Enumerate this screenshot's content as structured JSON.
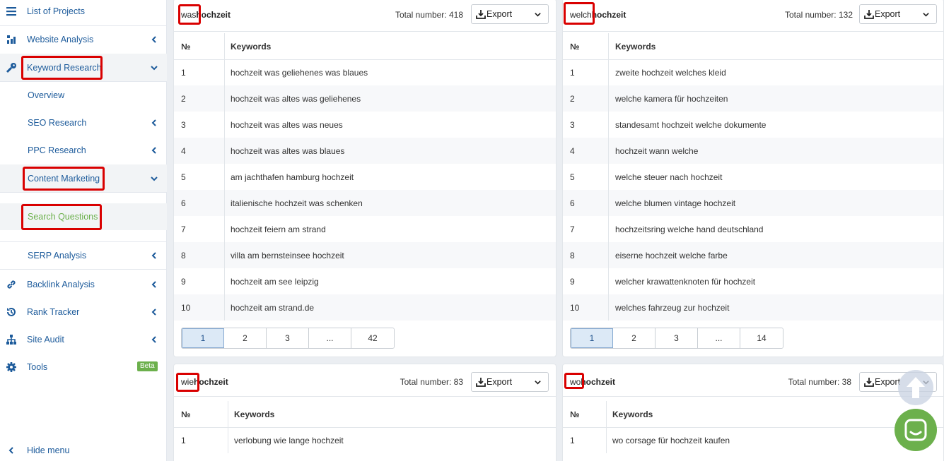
{
  "sidebar": {
    "list_projects": "List of Projects",
    "website_analysis": "Website Analysis",
    "keyword_research": "Keyword Research",
    "overview": "Overview",
    "seo_research": "SEO Research",
    "ppc_research": "PPC Research",
    "content_marketing": "Content Marketing",
    "search_questions": "Search Questions",
    "serp_analysis": "SERP Analysis",
    "backlink_analysis": "Backlink Analysis",
    "rank_tracker": "Rank Tracker",
    "site_audit": "Site Audit",
    "tools": "Tools",
    "beta": "Beta",
    "hide_menu": "Hide menu"
  },
  "colors": {
    "accent": "#1d5b9b",
    "highlight": "#d90000",
    "green": "#6cb04c"
  },
  "panels": [
    {
      "qword": "was",
      "rest": "hochzeit",
      "total": "Total number: 418",
      "export": "Export",
      "col_num": "№",
      "col_kw": "Keywords",
      "rows": [
        {
          "n": "1",
          "k": "hochzeit was geliehenes was blaues"
        },
        {
          "n": "2",
          "k": "hochzeit was altes was geliehenes"
        },
        {
          "n": "3",
          "k": "hochzeit was altes was neues"
        },
        {
          "n": "4",
          "k": "hochzeit was altes was blaues"
        },
        {
          "n": "5",
          "k": "am jachthafen hamburg hochzeit"
        },
        {
          "n": "6",
          "k": "italienische hochzeit was schenken"
        },
        {
          "n": "7",
          "k": "hochzeit feiern am strand"
        },
        {
          "n": "8",
          "k": "villa am bernsteinsee hochzeit"
        },
        {
          "n": "9",
          "k": "hochzeit am see leipzig"
        },
        {
          "n": "10",
          "k": "hochzeit am strand.de"
        }
      ],
      "pages": [
        "1",
        "2",
        "3",
        "...",
        "42"
      ]
    },
    {
      "qword": "welch",
      "rest": "hochzeit",
      "total": "Total number: 132",
      "export": "Export",
      "col_num": "№",
      "col_kw": "Keywords",
      "rows": [
        {
          "n": "1",
          "k": "zweite hochzeit welches kleid"
        },
        {
          "n": "2",
          "k": "welche kamera für hochzeiten"
        },
        {
          "n": "3",
          "k": "standesamt hochzeit welche dokumente"
        },
        {
          "n": "4",
          "k": "hochzeit wann welche"
        },
        {
          "n": "5",
          "k": "welche steuer nach hochzeit"
        },
        {
          "n": "6",
          "k": "welche blumen vintage hochzeit"
        },
        {
          "n": "7",
          "k": "hochzeitsring welche hand deutschland"
        },
        {
          "n": "8",
          "k": "eiserne hochzeit welche farbe"
        },
        {
          "n": "9",
          "k": "welcher krawattenknoten für hochzeit"
        },
        {
          "n": "10",
          "k": "welches fahrzeug zur hochzeit"
        }
      ],
      "pages": [
        "1",
        "2",
        "3",
        "...",
        "14"
      ]
    },
    {
      "qword": "wie",
      "rest": "hochzeit",
      "total": "Total number: 83",
      "export": "Export",
      "col_num": "№",
      "col_kw": "Keywords",
      "rows": [
        {
          "n": "1",
          "k": "verlobung wie lange hochzeit"
        }
      ]
    },
    {
      "qword": "wo",
      "rest": "hochzeit",
      "total": "Total number: 38",
      "export": "Export",
      "col_num": "№",
      "col_kw": "Keywords",
      "rows": [
        {
          "n": "1",
          "k": "wo corsage für hochzeit kaufen"
        }
      ]
    }
  ]
}
